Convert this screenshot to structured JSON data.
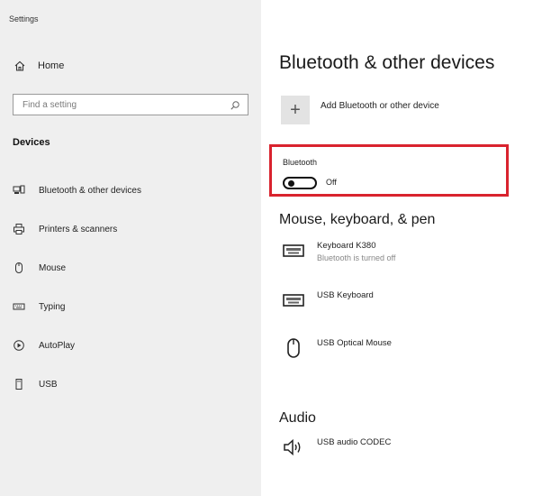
{
  "window": {
    "title": "Settings"
  },
  "sidebar": {
    "home_label": "Home",
    "search_placeholder": "Find a setting",
    "section_title": "Devices",
    "items": [
      {
        "label": "Bluetooth & other devices",
        "icon": "bluetooth-devices-icon"
      },
      {
        "label": "Printers & scanners",
        "icon": "printer-icon"
      },
      {
        "label": "Mouse",
        "icon": "mouse-icon"
      },
      {
        "label": "Typing",
        "icon": "keyboard-icon"
      },
      {
        "label": "AutoPlay",
        "icon": "autoplay-icon"
      },
      {
        "label": "USB",
        "icon": "usb-icon"
      }
    ]
  },
  "main": {
    "title": "Bluetooth & other devices",
    "add_device_label": "Add Bluetooth or other device",
    "bluetooth": {
      "label": "Bluetooth",
      "state": "Off",
      "highlight_color": "#d9232e"
    },
    "mouse_keyboard_pen": {
      "heading": "Mouse, keyboard, & pen",
      "devices": [
        {
          "name": "Keyboard K380",
          "status": "Bluetooth is turned off",
          "icon": "keyboard-icon"
        },
        {
          "name": "USB Keyboard",
          "status": "",
          "icon": "keyboard-icon"
        },
        {
          "name": "USB Optical Mouse",
          "status": "",
          "icon": "mouse-icon"
        }
      ]
    },
    "audio": {
      "heading": "Audio",
      "devices": [
        {
          "name": "USB audio CODEC",
          "icon": "speaker-icon"
        }
      ]
    }
  }
}
